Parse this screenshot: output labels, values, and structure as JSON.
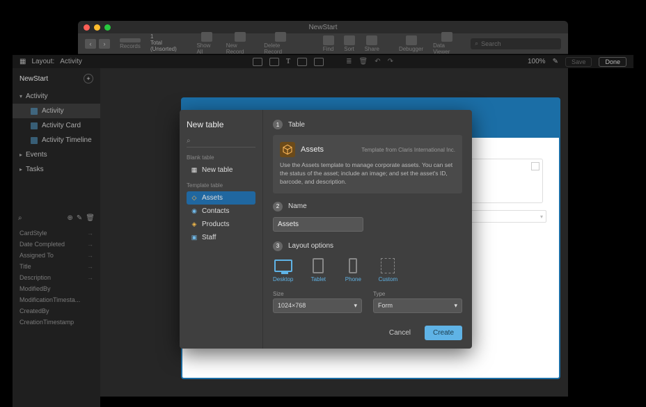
{
  "window": {
    "title": "NewStart"
  },
  "toolbar": {
    "record_num": "1",
    "record_total": "Total (Unsorted)",
    "records_label": "Records",
    "show_all": "Show All",
    "new_record": "New Record",
    "delete_record": "Delete Record",
    "find": "Find",
    "sort": "Sort",
    "share": "Share",
    "debugger": "Debugger",
    "data_viewer": "Data Viewer",
    "search_placeholder": "Search"
  },
  "layout_bar": {
    "label": "Layout:",
    "current": "Activity",
    "zoom": "100%",
    "save": "Save",
    "done": "Done"
  },
  "sidebar": {
    "title": "NewStart",
    "groups": [
      {
        "label": "Activity",
        "expanded": true,
        "items": [
          "Activity",
          "Activity Card",
          "Activity Timeline"
        ],
        "selected": 0
      },
      {
        "label": "Events",
        "expanded": false
      },
      {
        "label": "Tasks",
        "expanded": false
      }
    ],
    "fields": [
      "CardStyle",
      "Date Completed",
      "Assigned To",
      "Title",
      "Description",
      "ModifiedBy",
      "ModificationTimesta...",
      "CreatedBy",
      "CreationTimestamp"
    ]
  },
  "modal": {
    "title": "New table",
    "blank_label": "Blank table",
    "blank_item": "New table",
    "template_label": "Template table",
    "templates": [
      {
        "name": "Assets",
        "color": "#ffb74d",
        "icon": "cube"
      },
      {
        "name": "Contacts",
        "color": "#6fb7e6",
        "icon": "person"
      },
      {
        "name": "Products",
        "color": "#f0b84a",
        "icon": "tag"
      },
      {
        "name": "Staff",
        "color": "#6fb7e6",
        "icon": "badge"
      }
    ],
    "selected_template": 0,
    "step1_label": "Table",
    "step2_label": "Name",
    "step3_label": "Layout options",
    "card": {
      "name": "Assets",
      "source": "Template from Claris International Inc.",
      "description": "Use the Assets template to manage corporate assets. You can set the status of the asset; include an image; and set the asset's ID, barcode, and description."
    },
    "name_value": "Assets",
    "layout_options": [
      "Desktop",
      "Tablet",
      "Phone",
      "Custom"
    ],
    "layout_selected": 0,
    "size_label": "Size",
    "size_value": "1024×768",
    "type_label": "Type",
    "type_value": "Form",
    "cancel": "Cancel",
    "create": "Create"
  }
}
